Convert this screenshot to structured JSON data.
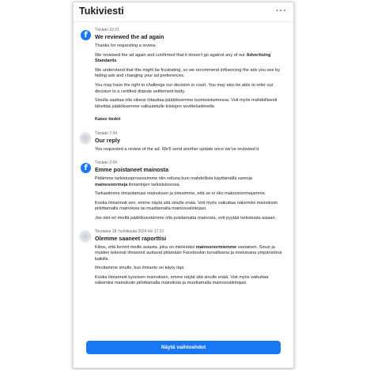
{
  "window": {
    "title": "Tukiviesti",
    "more_label": "···"
  },
  "messages": [
    {
      "time": "Tänään 10:21",
      "title": "We reviewed the ad again",
      "p1": "Thanks for requesting a review.",
      "p2a": "We reviewed the ad again and confirmed that it doesn't go against any of our ",
      "p2b": "Advertising Standards",
      "p2c": ".",
      "p3": "We understand that this might be frustrating, so we recommend influencing the ads you see by hiding ads and changing your ad preferences.",
      "p4": "You may have the right to challenge our decision in court. You may also be able to refer our decision to a certified dispute settlement body.",
      "p5": "Sinulla saattaa olla oikeus riitauttaa päätöksemme tuomioistuimessa. Voit myös mahdollisesti lähettää päätöksemme valtuutetulle kiistojen sovitteluelimelle.",
      "link": "Katso tiedot"
    },
    {
      "time": "Tänään 7:34",
      "title": "Our reply",
      "p1": "You requested a review of the ad. We'll send another update once we've reviewed it."
    },
    {
      "time": "Tänään 2:04",
      "title": "Emme poistaneet mainosta",
      "p1a": "Pidämme tarkistusprosessimme niin reiluna kuin mahdollista käyttämällä samoja ",
      "p1b": "mainosnormeja",
      "p1c": " ilmiantojen tarkistuksessa.",
      "p2": "Tarkastimme ilmiantamasi mainoksen ja totesimme, että se ei riko mainosnormejamme.",
      "p3": "Koska ilmiannoit sen, emme näytä sitä sinulle enää. Voit myös vaikuttaa näkemiisi mainoksiin piilottamalla mainoksia tai muuttamalla mainosvalintojasi.",
      "p4": "Jos olet eri mieltä päätöksestämme olla poistamatta mainosta, voit pyytää tarkistusta asiaan."
    },
    {
      "time": "Torstaina 18. huhtikuuta 2024 klo 17:21",
      "title": "Olemme saaneet raporttisi",
      "p1a": "Kiitos, että kerroit meille asiasta, joka on mielestäsi ",
      "p1b": "mainosnormiemme",
      "p1c": " vastainen. Sinun ja muiden tekemät ilmiannot auttavat pitämään Facebookin turvallisena ja mieluisana ympäristönä kaikille.",
      "p2": "Ilmoitamme sinulle, kun ilmianto on käyty läpi.",
      "p3": "Koska ilmiannoit kyseisen mainoksen, emme näytä sitä sinulle enää. Voit myös vaikuttaa näkemiisi mainoksiin piilottamalla mainoksia ja muuttamalla mainosvalintojasi."
    }
  ],
  "action_button": "Näytä vaihtoehdot",
  "icons": {
    "facebook": "facebook-logo-icon",
    "more": "more-horizontal-icon"
  },
  "colors": {
    "accent": "#1877f2",
    "text": "#1c1e21",
    "muted": "#65676b"
  }
}
